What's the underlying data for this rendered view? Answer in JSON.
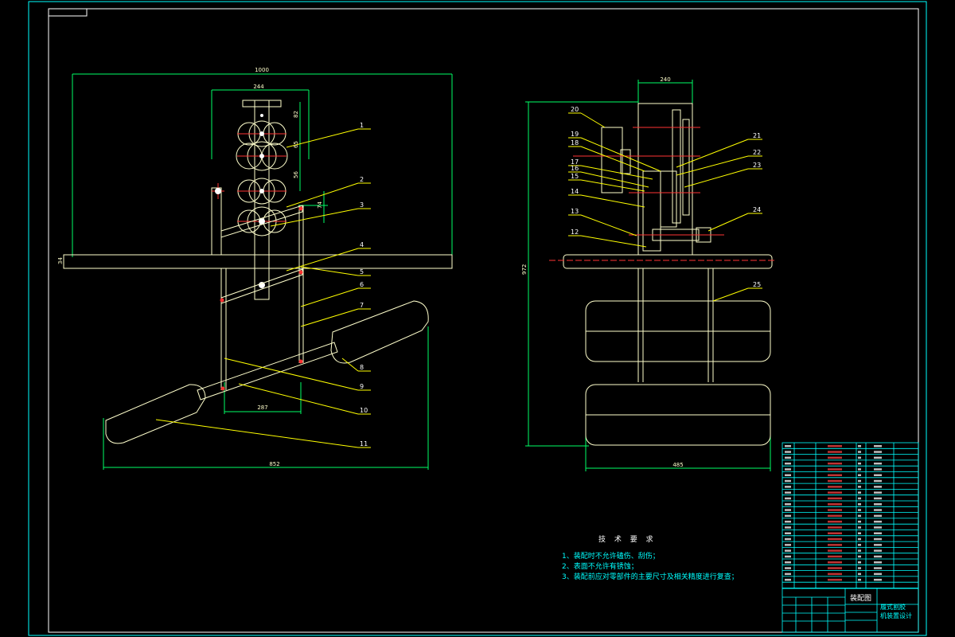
{
  "colors": {
    "border": "#00ffff",
    "geometry": "#ffffcc",
    "dimension": "#00ff66",
    "leader": "#ffff00",
    "center": "#ff3333",
    "table": "#00ffff",
    "text": "#ffffff"
  },
  "front_view": {
    "dimensions": {
      "overall_width": "1000",
      "frame_width": "244",
      "d1": "82",
      "d2": "65",
      "d3": "56",
      "d4": "74",
      "d5": "34",
      "lower_width": "287",
      "span": "852"
    },
    "part_labels": [
      "1",
      "2",
      "3",
      "4",
      "5",
      "6",
      "7",
      "8",
      "9",
      "10",
      "11"
    ]
  },
  "side_view": {
    "dimensions": {
      "top_width": "240",
      "height": "972",
      "bottom_width": "485"
    },
    "part_labels": [
      "12",
      "13",
      "14",
      "15",
      "16",
      "17",
      "18",
      "19",
      "20",
      "21",
      "22",
      "23",
      "24",
      "25"
    ]
  },
  "technical_requirements": {
    "title": "技 术 要 求",
    "items": [
      "1、装配时不允许磕伤、刮伤；",
      "2、表面不允许有锈蚀；",
      "3、装配前应对零部件的主要尺寸及相关精度进行复查；"
    ]
  },
  "title_block": {
    "drawing_name": "装配图",
    "project_title": "履式割胶机装置设计"
  }
}
